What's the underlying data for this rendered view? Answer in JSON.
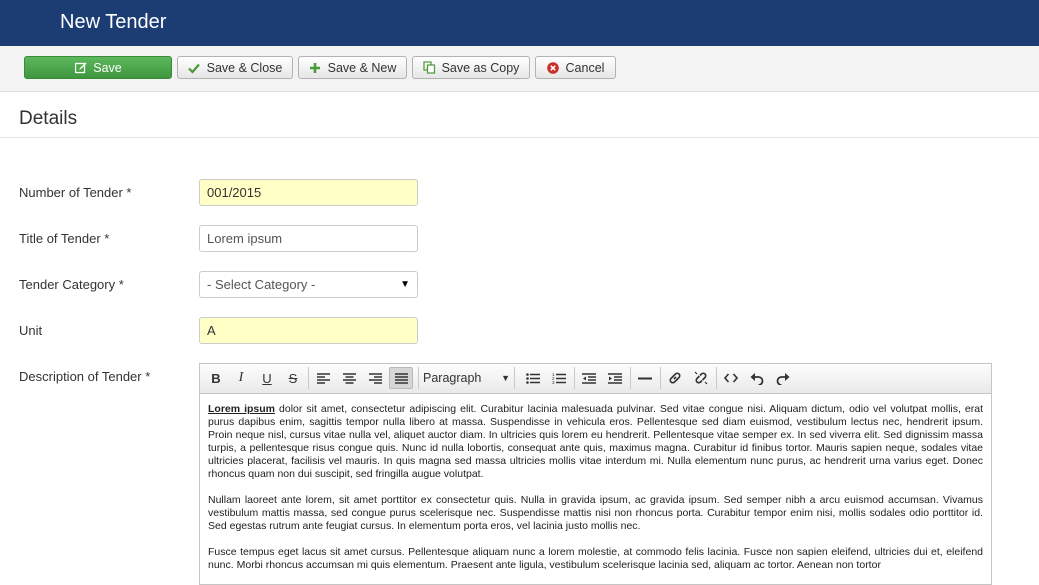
{
  "header": {
    "title": "New Tender"
  },
  "toolbar": {
    "save": "Save",
    "save_close": "Save & Close",
    "save_new": "Save & New",
    "save_copy": "Save as Copy",
    "cancel": "Cancel"
  },
  "section": {
    "title": "Details"
  },
  "form": {
    "number": {
      "label": "Number of Tender *",
      "value": "001/2015"
    },
    "title": {
      "label": "Title of Tender *",
      "value": "Lorem ipsum"
    },
    "category": {
      "label": "Tender Category *",
      "value": "- Select Category -"
    },
    "unit": {
      "label": "Unit",
      "value": "A"
    },
    "description": {
      "label": "Description of Tender *"
    }
  },
  "editor": {
    "format_value": "Paragraph",
    "p1_lead": "Lorem ipsum",
    "p1": " dolor sit amet, consectetur adipiscing elit. Curabitur lacinia malesuada pulvinar. Sed vitae congue nisi. Aliquam dictum, odio vel volutpat mollis, erat purus dapibus enim, sagittis tempor nulla libero at massa. Suspendisse in vehicula eros. Pellentesque sed diam euismod, vestibulum lectus nec, hendrerit ipsum. Proin neque nisl, cursus vitae nulla vel, aliquet auctor diam. In ultricies quis lorem eu hendrerit. Pellentesque vitae semper ex. In sed viverra elit. Sed dignissim massa turpis, a pellentesque risus congue quis. Nunc id nulla lobortis, consequat ante quis, maximus magna. Curabitur id finibus tortor. Mauris sapien neque, sodales vitae ultricies placerat, facilisis vel mauris. In quis magna sed massa ultricies mollis vitae interdum mi. Nulla elementum nunc purus, ac hendrerit urna varius eget. Donec rhoncus quam non dui suscipit, sed fringilla augue volutpat.",
    "p2": "Nullam laoreet ante lorem, sit amet porttitor ex consectetur quis. Nulla in gravida ipsum, ac gravida ipsum. Sed semper nibh a arcu euismod accumsan. Vivamus vestibulum mattis massa, sed congue purus scelerisque nec. Suspendisse mattis nisi non rhoncus porta. Curabitur tempor enim nisi, mollis sodales odio porttitor id. Sed egestas rutrum ante feugiat cursus. In elementum porta eros, vel lacinia justo mollis nec.",
    "p3": "Fusce tempus eget lacus sit amet cursus. Pellentesque aliquam nunc a lorem molestie, at commodo felis lacinia. Fusce non sapien eleifend, ultricies dui et, eleifend nunc. Morbi rhoncus accumsan mi quis elementum. Praesent ante ligula, vestibulum scelerisque lacinia sed, aliquam ac tortor. Aenean non tortor"
  }
}
